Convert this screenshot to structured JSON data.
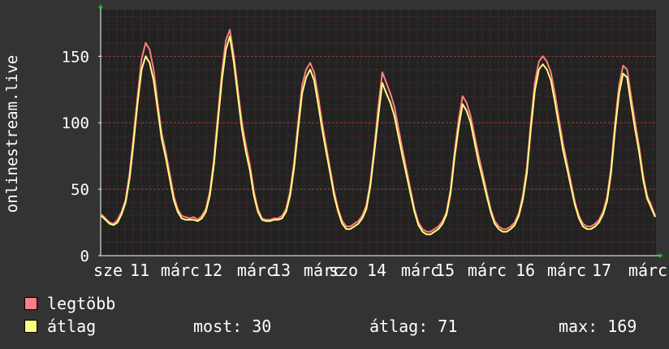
{
  "chart_data": {
    "type": "line",
    "ylabel": "onlinestream.live",
    "ylim": [
      0,
      185
    ],
    "yticks": [
      0,
      50,
      100,
      150
    ],
    "xticks": [
      "sze",
      "11",
      "márc",
      "12",
      "márc",
      "13",
      "márc",
      "szo",
      "14",
      "márc",
      "15",
      "márc",
      "16",
      "márc",
      "17",
      "márc"
    ],
    "grid": true,
    "series": [
      {
        "name": "legtöbb",
        "color": "#ff7f7f",
        "values": [
          31,
          28,
          25,
          24,
          27,
          33,
          42,
          62,
          90,
          120,
          148,
          160,
          155,
          140,
          115,
          92,
          78,
          62,
          45,
          35,
          30,
          29,
          28,
          29,
          27,
          30,
          35,
          48,
          72,
          105,
          138,
          162,
          170,
          150,
          125,
          100,
          83,
          68,
          48,
          35,
          28,
          27,
          27,
          28,
          28,
          30,
          35,
          48,
          70,
          100,
          128,
          140,
          145,
          138,
          120,
          100,
          82,
          65,
          48,
          35,
          26,
          22,
          22,
          24,
          26,
          30,
          38,
          55,
          82,
          112,
          138,
          130,
          122,
          112,
          96,
          80,
          65,
          50,
          35,
          25,
          20,
          18,
          18,
          20,
          22,
          26,
          33,
          50,
          78,
          102,
          120,
          115,
          105,
          90,
          75,
          62,
          48,
          35,
          26,
          22,
          20,
          20,
          22,
          25,
          32,
          45,
          66,
          100,
          130,
          146,
          150,
          146,
          138,
          122,
          103,
          85,
          70,
          55,
          40,
          30,
          24,
          22,
          22,
          24,
          27,
          33,
          44,
          66,
          100,
          128,
          143,
          140,
          120,
          100,
          82,
          60,
          45,
          38,
          30
        ]
      },
      {
        "name": "átlag",
        "color": "#ffff7f",
        "values": [
          30,
          27,
          24,
          23,
          25,
          31,
          40,
          58,
          85,
          115,
          140,
          150,
          145,
          132,
          110,
          88,
          74,
          58,
          42,
          33,
          28,
          27,
          27,
          27,
          26,
          28,
          33,
          45,
          68,
          100,
          132,
          155,
          165,
          145,
          120,
          95,
          78,
          64,
          45,
          33,
          27,
          26,
          26,
          27,
          27,
          28,
          33,
          45,
          66,
          95,
          122,
          134,
          140,
          132,
          114,
          95,
          78,
          62,
          45,
          33,
          24,
          20,
          20,
          22,
          24,
          28,
          35,
          52,
          78,
          105,
          130,
          122,
          115,
          105,
          90,
          75,
          61,
          47,
          33,
          23,
          18,
          16,
          16,
          18,
          20,
          24,
          31,
          47,
          74,
          96,
          114,
          109,
          100,
          85,
          70,
          58,
          45,
          33,
          24,
          20,
          18,
          18,
          20,
          23,
          30,
          42,
          62,
          95,
          124,
          140,
          144,
          140,
          132,
          116,
          98,
          80,
          66,
          52,
          38,
          28,
          22,
          20,
          20,
          22,
          25,
          31,
          41,
          62,
          95,
          122,
          137,
          134,
          114,
          95,
          78,
          57,
          43,
          36,
          29
        ]
      }
    ]
  },
  "legend": {
    "items": [
      {
        "label": "legtöbb",
        "color": "#ff7f7f"
      },
      {
        "label": "átlag",
        "color": "#ffff7f"
      }
    ]
  },
  "stats": {
    "now": "most: 30",
    "avg": "átlag: 71",
    "max": "max: 169"
  }
}
